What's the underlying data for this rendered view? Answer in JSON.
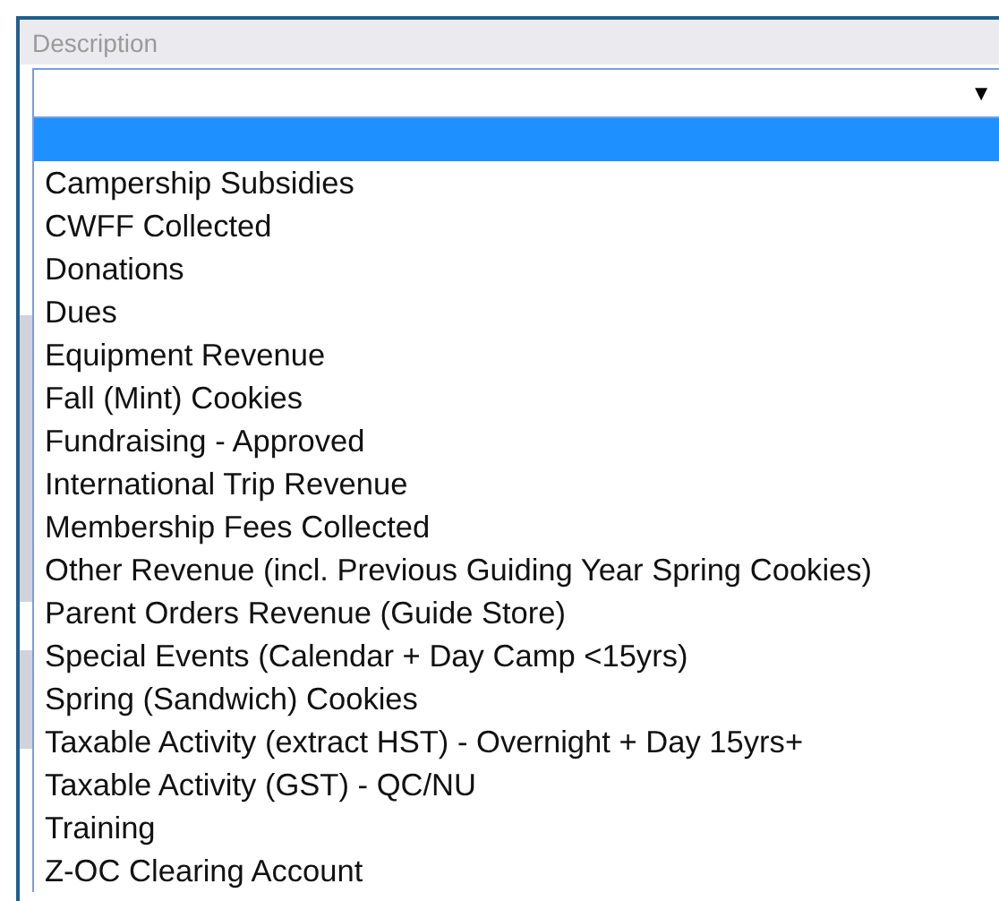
{
  "field": {
    "label": "Description",
    "caret": "▼"
  },
  "dropdown": {
    "options": [
      {
        "selected": true
      },
      {
        "label": "Campership Subsidies",
        "selected": false
      },
      {
        "label": "CWFF Collected",
        "selected": false
      },
      {
        "label": "Donations",
        "selected": false
      },
      {
        "label": "Dues",
        "selected": false
      },
      {
        "label": "Equipment Revenue",
        "selected": false
      },
      {
        "label": "Fall (Mint) Cookies",
        "selected": false
      },
      {
        "label": "Fundraising - Approved",
        "selected": false
      },
      {
        "label": "International Trip Revenue",
        "selected": false
      },
      {
        "label": "Membership Fees Collected",
        "selected": false
      },
      {
        "label": "Other Revenue (incl. Previous Guiding Year Spring Cookies)",
        "selected": false
      },
      {
        "label": "Parent Orders Revenue (Guide Store)",
        "selected": false
      },
      {
        "label": "Special Events (Calendar + Day Camp <15yrs)",
        "selected": false
      },
      {
        "label": "Spring (Sandwich) Cookies",
        "selected": false
      },
      {
        "label": "Taxable Activity (extract HST) - Overnight + Day 15yrs+",
        "selected": false
      },
      {
        "label": "Taxable Activity (GST) - QC/NU",
        "selected": false
      },
      {
        "label": "Training",
        "selected": false
      },
      {
        "label": "Z-OC Clearing Account",
        "selected": false
      }
    ]
  }
}
